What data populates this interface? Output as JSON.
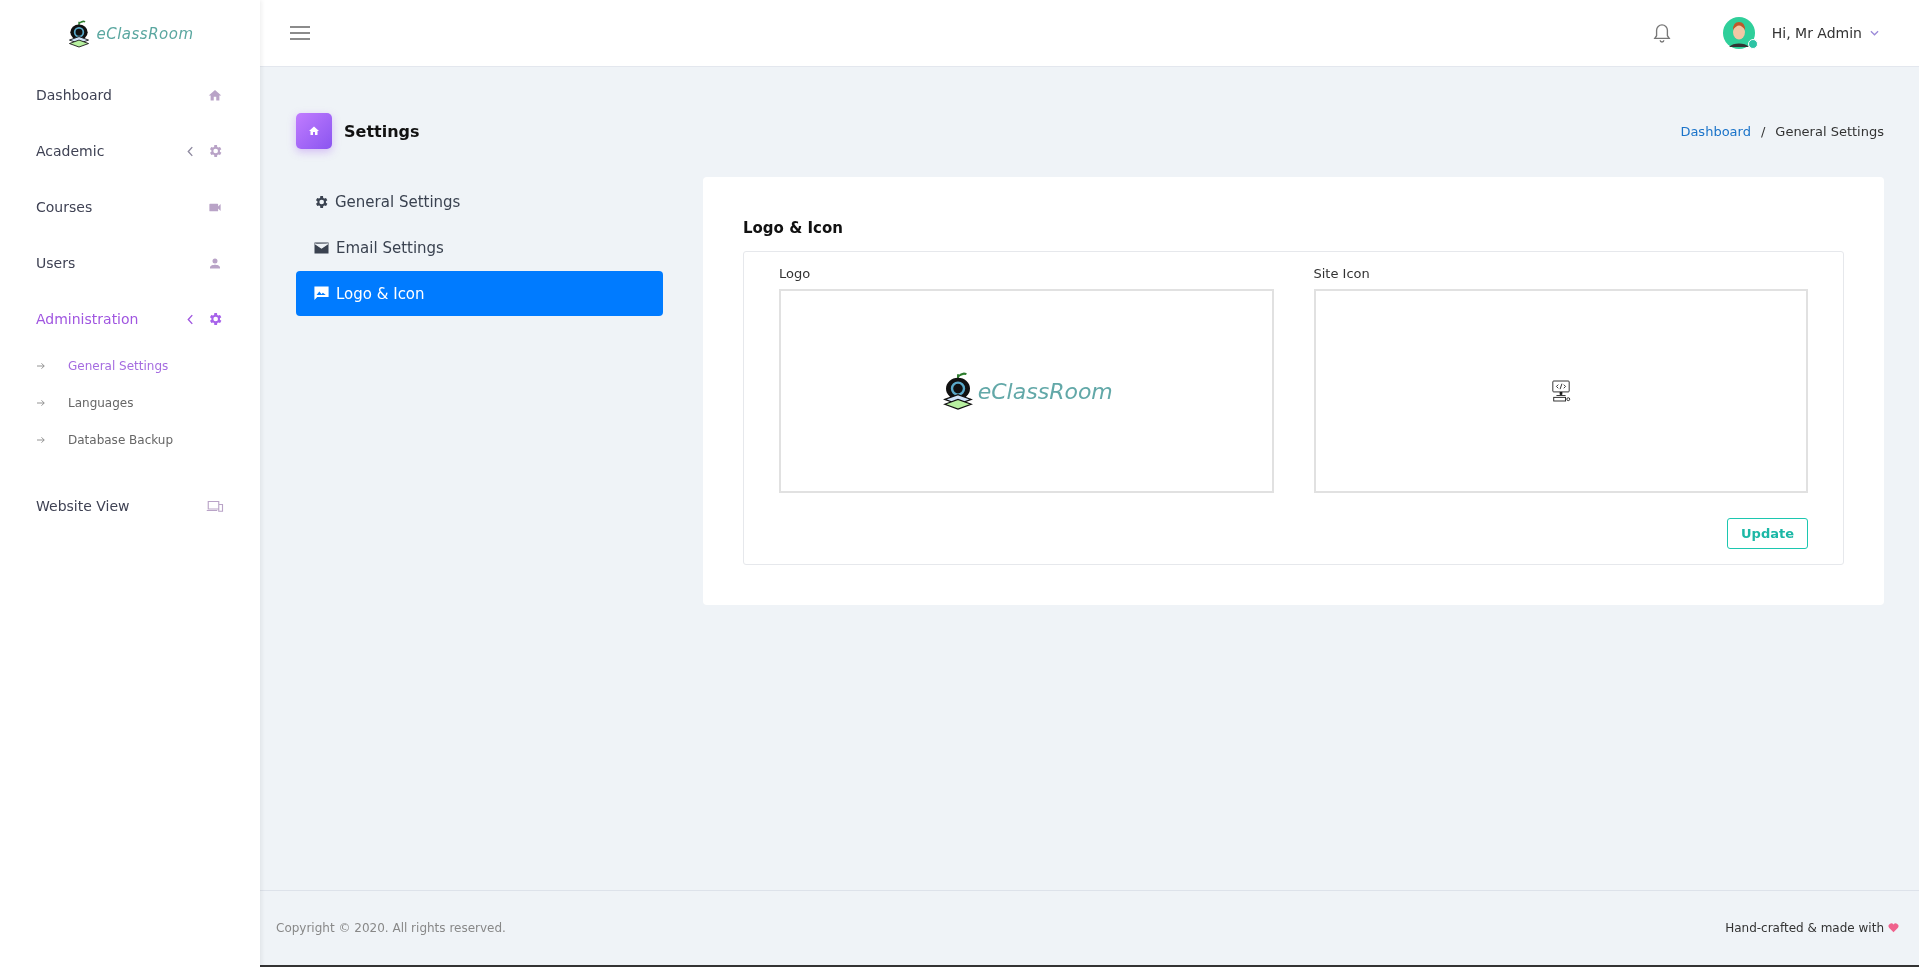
{
  "brand": {
    "logo_text": "eClassRoom"
  },
  "sidebar": {
    "items": [
      {
        "label": "Dashboard",
        "kind": "home",
        "expandable": false,
        "selected": false
      },
      {
        "label": "Academic",
        "kind": "gear",
        "expandable": true,
        "selected": false
      },
      {
        "label": "Courses",
        "kind": "video",
        "expandable": false,
        "selected": false
      },
      {
        "label": "Users",
        "kind": "user",
        "expandable": false,
        "selected": false
      },
      {
        "label": "Administration",
        "kind": "gear",
        "expandable": true,
        "selected": true,
        "children": [
          {
            "label": "General Settings",
            "selected": true
          },
          {
            "label": "Languages",
            "selected": false
          },
          {
            "label": "Database Backup",
            "selected": false
          }
        ]
      },
      {
        "label": "Website View",
        "kind": "devices",
        "expandable": false,
        "selected": false
      }
    ]
  },
  "header": {
    "greeting": "Hi, Mr Admin"
  },
  "page": {
    "title": "Settings",
    "breadcrumb": [
      {
        "label": "Dashboard",
        "link": true
      },
      {
        "label": "/",
        "link": false
      },
      {
        "label": "General Settings",
        "link": false
      }
    ]
  },
  "settings_tabs": [
    {
      "label": "General Settings",
      "kind": "gear",
      "selected": false
    },
    {
      "label": "Email Settings",
      "kind": "mail",
      "selected": false
    },
    {
      "label": "Logo & Icon",
      "kind": "image",
      "selected": true
    }
  ],
  "card": {
    "title": "Logo & Icon",
    "fields": [
      {
        "label": "Logo",
        "kind": "logo",
        "logo_text": "eClassRoom"
      },
      {
        "label": "Site Icon",
        "kind": "icon"
      }
    ],
    "button": "Update"
  },
  "footer": {
    "copyright": "Copyright © 2020. All rights reserved.",
    "credit": "Hand-crafted & made with"
  }
}
